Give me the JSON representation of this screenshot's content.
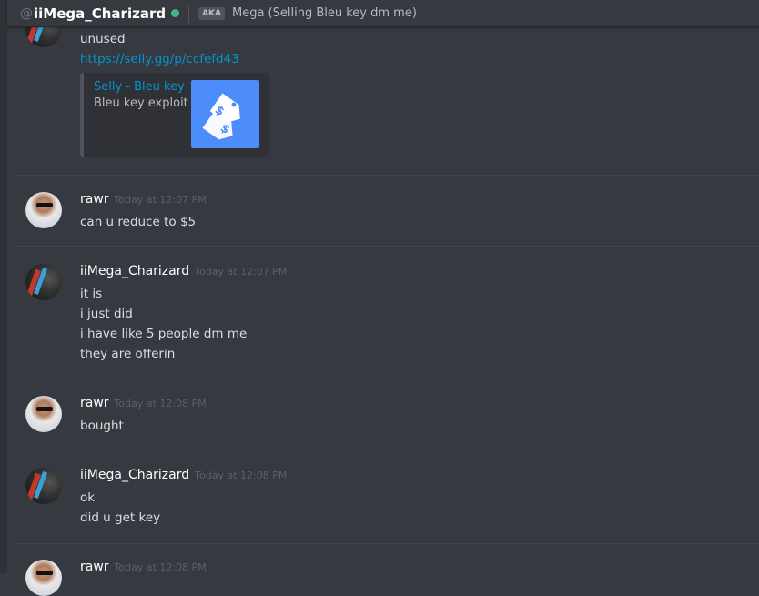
{
  "header": {
    "at": "@",
    "username": "iiMega_Charizard",
    "status": "online",
    "status_color": "#43b581",
    "aka_label": "AKA",
    "nickname": "Mega (Selling Bleu key dm me)"
  },
  "messages": [
    {
      "author": "iiMega_Charizard",
      "avatar": "mega",
      "lines": [
        "unused"
      ],
      "link": "https://selly.gg/p/ccfefd43",
      "embed": {
        "title": "Selly - Bleu key",
        "description": "Bleu key exploit",
        "thumbnail_icon": "price-tag-icon"
      }
    },
    {
      "author": "rawr",
      "avatar": "rawr",
      "timestamp": "Today at 12:07 PM",
      "lines": [
        "can u reduce to $5"
      ]
    },
    {
      "author": "iiMega_Charizard",
      "avatar": "mega",
      "timestamp": "Today at 12:07 PM",
      "lines": [
        "it is",
        "i just did",
        "i have like 5 people dm me",
        "they are offerin"
      ]
    },
    {
      "author": "rawr",
      "avatar": "rawr",
      "timestamp": "Today at 12:08 PM",
      "lines": [
        "bought"
      ]
    },
    {
      "author": "iiMega_Charizard",
      "avatar": "mega",
      "timestamp": "Today at 12:08 PM",
      "lines": [
        "ok",
        "did u get key"
      ]
    },
    {
      "author": "rawr",
      "avatar": "rawr",
      "timestamp": "Today at 12:08 PM",
      "lines": []
    }
  ]
}
